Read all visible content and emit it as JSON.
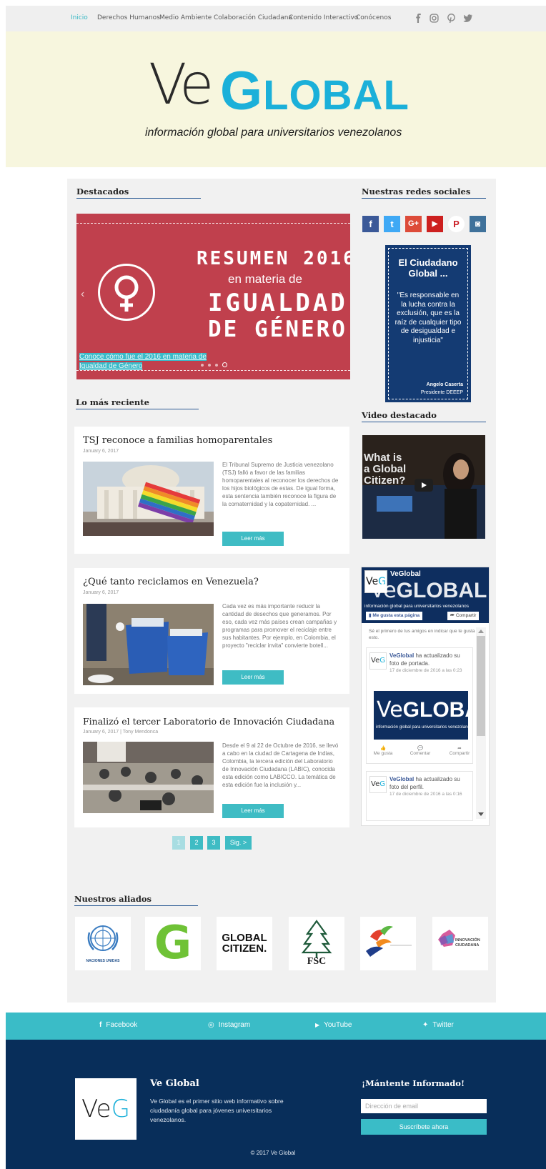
{
  "nav": {
    "items": [
      {
        "label": "Inicio",
        "active": true
      },
      {
        "label": "Derechos Humanos"
      },
      {
        "label": "Medio Ambiente"
      },
      {
        "label": "Colaboración Ciudadana"
      },
      {
        "label": "Contenido Interactivo"
      },
      {
        "label": "Conócenos"
      }
    ],
    "social_icons": [
      "facebook-icon",
      "instagram-icon",
      "pinterest-icon",
      "twitter-icon"
    ]
  },
  "banner": {
    "logo_ve": "Ve",
    "logo_g": "G",
    "logo_lobal": "LOBAL",
    "tagline": "información global para universitarios venezolanos"
  },
  "featured": {
    "title": "Destacados",
    "slide": {
      "line1": "RESUMEN 2016",
      "line2": "en materia de",
      "line3": "IGUALDAD",
      "line4": "DE GÉNERO",
      "caption": "Conoce cómo fue el 2016 en materia de Igualdad  de Género"
    }
  },
  "recent": {
    "title": "Lo más reciente",
    "posts": [
      {
        "title": "TSJ reconoce a familias homoparentales",
        "meta": "January 6, 2017",
        "excerpt": "El Tribunal Supremo de Justicia venezolano (TSJ) falló a favor de las familias homoparentales al reconocer los derechos de los hijos biológicos de estas.  De igual forma, esta sentencia también reconoce la figura de la comaternidad y la copaternidad. ...",
        "button": "Leer más"
      },
      {
        "title": "¿Qué tanto reciclamos en Venezuela?",
        "meta": "January 6, 2017",
        "excerpt": "Cada vez es más importante reducir la cantidad de desechos que generamos. Por eso, cada vez más países crean campañas y programas para promover el reciclaje entre sus habitantes. Por ejemplo, en Colombia, el proyecto \"reciclar invita\" convierte botell...",
        "button": "Leer más"
      },
      {
        "title": "Finalizó el tercer Laboratorio de Innovación Ciudadana",
        "meta": "January 6, 2017   |  Tony Mendonca",
        "excerpt": "Desde el 9 al 22 de Octubre de 2016, se llevó a cabo en la ciudad de Cartagena de Indias, Colombia, la tercera edición del Laboratorio de Innovación Ciudadana (LABIC), conocida esta edición como LABICCO. La temática de esta edición fue la inclusión y...",
        "button": "Leer más"
      }
    ],
    "pagination": [
      "1",
      "2",
      "3",
      "Sig. >"
    ]
  },
  "sidebar": {
    "social_title": "Nuestras redes sociales",
    "social_squares": [
      {
        "icon": "facebook-icon",
        "glyph": "f",
        "color": "#3b5998"
      },
      {
        "icon": "twitter-icon",
        "glyph": "t",
        "color": "#3fa9f5"
      },
      {
        "icon": "google-plus-icon",
        "glyph": "G+",
        "color": "#dd4b39"
      },
      {
        "icon": "youtube-icon",
        "glyph": "▶",
        "color": "#cd201f"
      },
      {
        "icon": "pinterest-icon",
        "glyph": "P",
        "color": "#ffffff"
      },
      {
        "icon": "instagram-icon",
        "glyph": "◙",
        "color": "#3f729b"
      }
    ],
    "quote": {
      "title": "El Ciudadano Global ...",
      "text": "\"Es responsable en la lucha contra la exclusión, que es la raíz de cualquier tipo de desigualdad e injusticia\"",
      "author": "Angelo Caserta",
      "role": "Presidente DEEEP"
    },
    "video_title": "Video destacado",
    "video_text": "What is a Global Citizen?",
    "fb": {
      "page_name": "VeGlobal",
      "cover_tagline": "información global para universitarios venezolanos",
      "like_btn": "Me gusta esta página",
      "share_btn": "Compartir",
      "friends_text": "Sé el primero de tus amigos en indicar que te gusta esto.",
      "post1_author": "VeGlobal",
      "post1_text": " ha actualizado su foto de portada.",
      "post1_date": "17 de diciembre de 2016 a las 0:23",
      "action_like": "Me gusta",
      "action_comment": "Comentar",
      "action_share": "Compartir",
      "post2_author": "VeGlobal",
      "post2_text": " ha actualizado su foto del perfil.",
      "post2_date": "17 de diciembre de 2016 a las 0:16"
    }
  },
  "allies": {
    "title": "Nuestros aliados",
    "items": [
      {
        "name": "NACIONES UNIDAS"
      },
      {
        "name": "G"
      },
      {
        "name": "GLOBAL CITIZEN."
      },
      {
        "name": "FSC"
      },
      {
        "name": "swirl-logo"
      },
      {
        "name": "INNOVACIÓN CIUDADANA"
      }
    ]
  },
  "footer": {
    "strip": [
      {
        "icon": "facebook-icon",
        "glyph": "f",
        "label": "Facebook"
      },
      {
        "icon": "instagram-icon",
        "glyph": "◎",
        "label": "Instagram"
      },
      {
        "icon": "youtube-icon",
        "glyph": "▶",
        "label": "YouTube"
      },
      {
        "icon": "twitter-icon",
        "glyph": "✦",
        "label": "Twitter"
      }
    ],
    "brand_title": "Ve Global",
    "brand_logo_ve": "Ve",
    "brand_logo_g": "G",
    "brand_text": "Ve Global es el primer sitio web informativo sobre ciudadanía global para jóvenes universitarios venezolanos.",
    "newsletter_title": "¡Mántente Informado!",
    "email_placeholder": "Dirección de email",
    "subscribe_label": "Suscríbete ahora",
    "copyright": "© 2017 Ve Global"
  }
}
